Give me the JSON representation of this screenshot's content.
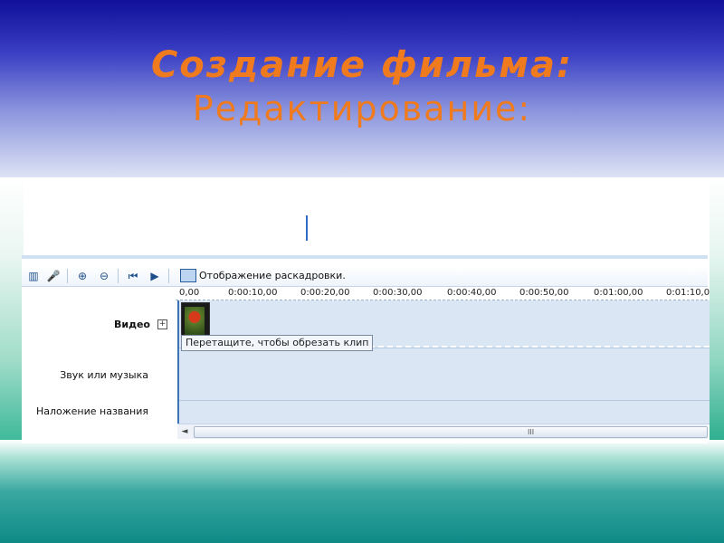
{
  "slide": {
    "title_line1": "Создание фильма:",
    "title_line2": "Редактирование:",
    "colors": {
      "title": "#f07a1e",
      "top_gradient": "#10109a",
      "bottom_gradient": "#0e8a86"
    }
  },
  "toolbar": {
    "icons": [
      "timeline-view-icon",
      "narrate-icon",
      "zoom-in-icon",
      "zoom-out-icon",
      "rewind-icon",
      "play-icon",
      "storyboard-icon"
    ],
    "show_storyboard_label": "Отображение раскадровки."
  },
  "ruler": {
    "ticks": [
      "0,00",
      "0:00:10,00",
      "0:00:20,00",
      "0:00:30,00",
      "0:00:40,00",
      "0:00:50,00",
      "0:01:00,00",
      "0:01:10,0"
    ]
  },
  "tracks": {
    "video_label": "Видео",
    "expand_symbol": "+",
    "audio_label": "Звук или музыка",
    "overlay_label": "Наложение названия"
  },
  "tooltip": "Перетащите, чтобы обрезать клип",
  "scrollbar": {
    "left_arrow": "◄",
    "grip": "III"
  }
}
